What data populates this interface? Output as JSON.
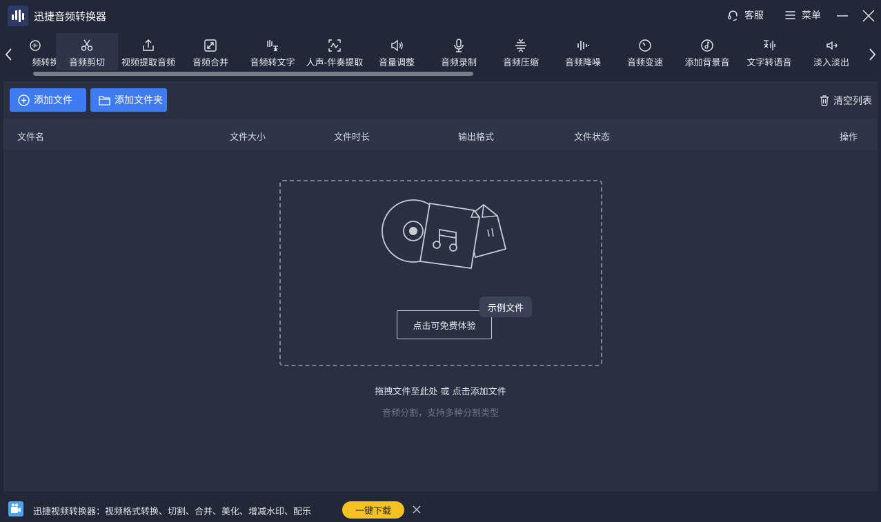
{
  "titlebar": {
    "app_title": "迅捷音频转换器",
    "service_label": "客服",
    "menu_label": "菜单"
  },
  "toolbar": {
    "tabs": [
      {
        "label": "频转换",
        "icon": "waveform-icon"
      },
      {
        "label": "音频剪切",
        "icon": "scissors-icon",
        "active": true
      },
      {
        "label": "视频提取音频",
        "icon": "export-icon"
      },
      {
        "label": "音频合并",
        "icon": "merge-icon"
      },
      {
        "label": "音频转文字",
        "icon": "text-convert-icon"
      },
      {
        "label": "人声-伴奏提取",
        "icon": "voice-extract-icon"
      },
      {
        "label": "音量调整",
        "icon": "volume-icon"
      },
      {
        "label": "音频录制",
        "icon": "microphone-icon"
      },
      {
        "label": "音频压缩",
        "icon": "compress-icon"
      },
      {
        "label": "音频降噪",
        "icon": "denoise-icon"
      },
      {
        "label": "音频变速",
        "icon": "speed-icon"
      },
      {
        "label": "添加背景音",
        "icon": "music-disc-icon"
      },
      {
        "label": "文字转语音",
        "icon": "tts-icon"
      },
      {
        "label": "淡入淡出",
        "icon": "fade-icon"
      }
    ]
  },
  "main": {
    "add_file_label": "添加文件",
    "add_folder_label": "添加文件夹",
    "clear_list_label": "清空列表",
    "columns": [
      "文件名",
      "文件大小",
      "文件时长",
      "输出格式",
      "文件状态",
      "操作"
    ],
    "trial_button_label": "点击可免费体验",
    "sample_badge_label": "示例文件",
    "drop_hint": "拖拽文件至此处 或 点击添加文件",
    "drop_subhint": "音频分割，支持多种分割类型"
  },
  "bottombar": {
    "promo_text": "迅捷视频转换器：视频格式转换、切割、合并、美化、增减水印、配乐",
    "download_label": "一键下载"
  },
  "colors": {
    "accent": "#3f7cf3",
    "download": "#f5c224",
    "background": "#232838",
    "panel": "#2a3042"
  }
}
